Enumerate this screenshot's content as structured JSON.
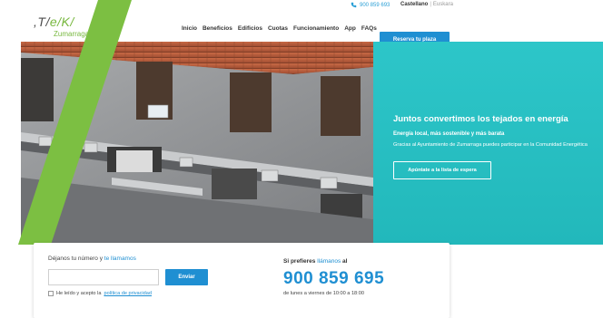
{
  "topbar": {
    "phone": "900 859 693",
    "lang_active": "Castellano",
    "lang_separator": "|",
    "lang_other": "Euskara"
  },
  "logo": {
    "mark_prefix": ",T/",
    "mark_mid": "e/K/",
    "place": "Zumarraga"
  },
  "nav": {
    "items": [
      "Inicio",
      "Beneficios",
      "Edificios",
      "Cuotas",
      "Funcionamiento",
      "App",
      "FAQs"
    ],
    "cta": "Reserva tu plaza"
  },
  "hero": {
    "title": "Juntos convertimos los tejados en energía",
    "subtitle": "Energía local, más sostenible y más barata",
    "description": "Gracias al Ayuntamiento de Zumarraga puedes participar en la Comunidad Energética",
    "waitlist_button": "Apúntate a la lista de espera"
  },
  "contact": {
    "ask_prefix": "Déjanos tu número y ",
    "ask_link": "te llamamos",
    "phone_input_value": "",
    "send_button": "Enviar",
    "consent_prefix": "He leído y acepto la ",
    "consent_link": "política de privacidad",
    "prefer_prefix": "Si prefieres ",
    "prefer_link": "llámanos",
    "prefer_suffix": " al",
    "big_phone": "900 859 695",
    "hours": "de lunes a viernes de 10:00 a 18:00"
  },
  "colors": {
    "brand_blue": "#1f8fd2",
    "brand_green": "#78b83f",
    "hero_teal": "#2dc6c9"
  },
  "icons": {
    "phone": "phone-icon"
  }
}
